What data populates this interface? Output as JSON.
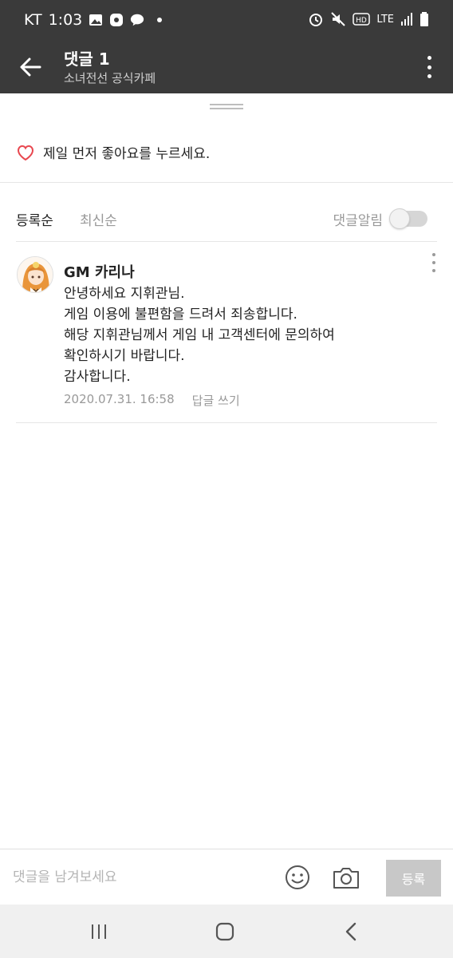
{
  "status_bar": {
    "carrier": "KT",
    "time": "1:03",
    "network": "LTE"
  },
  "header": {
    "title": "댓글 1",
    "subtitle": "소녀전선 공식카페"
  },
  "like_prompt": "제일 먼저 좋아요를 누르세요.",
  "sort": {
    "active": "등록순",
    "inactive": "최신순",
    "notify_label": "댓글알림",
    "notify_on": false
  },
  "comment": {
    "author": "GM 카리나",
    "lines": [
      "안녕하세요 지휘관님.",
      "게임 이용에 불편함을 드려서 죄송합니다.",
      "해당 지휘관님께서 게임 내 고객센터에 문의하여",
      "확인하시기 바랍니다.",
      "감사합니다."
    ],
    "date": "2020.07.31. 16:58",
    "reply_label": "답글 쓰기"
  },
  "input": {
    "placeholder": "댓글을 남겨보세요",
    "submit_label": "등록"
  },
  "colors": {
    "header_bg": "#3a3a3a",
    "heart": "#e8474f",
    "muted_text": "#999999"
  }
}
